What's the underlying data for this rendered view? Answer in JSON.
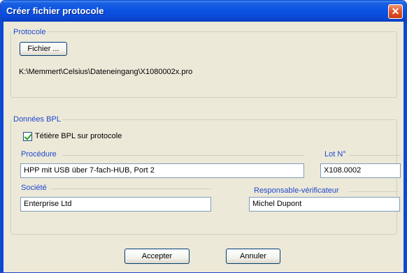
{
  "window": {
    "title": "Créer fichier protocole"
  },
  "protocole": {
    "group_title": "Protocole",
    "file_button": "Fichier ...",
    "path": "K:\\Memmert\\Celsius\\Dateneingang\\X1080002x.pro"
  },
  "bpl": {
    "group_title": "Données BPL",
    "checkbox_label": "Tétière BPL sur protocole",
    "checkbox_checked": true,
    "procedure_label": "Procédure",
    "procedure_value": "HPP mit USB über 7-fach-HUB, Port 2",
    "lot_label": "Lot N°",
    "lot_value": "X108.0002",
    "societe_label": "Société",
    "societe_value": "Enterprise Ltd",
    "responsable_label": "Responsable-vérificateur",
    "responsable_value": "Michel Dupont"
  },
  "buttons": {
    "accept": "Accepter",
    "cancel": "Annuler"
  }
}
